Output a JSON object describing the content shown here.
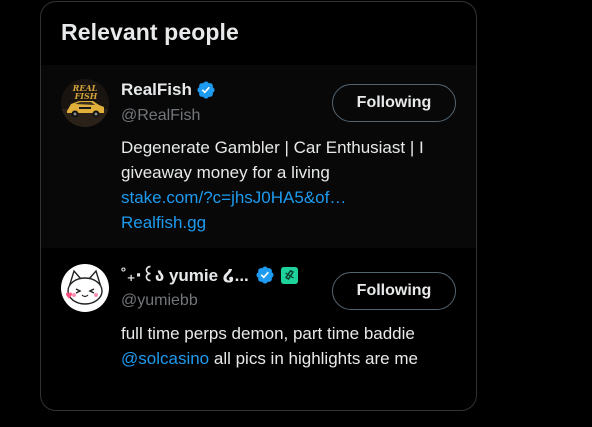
{
  "panel": {
    "title": "Relevant people"
  },
  "people": [
    {
      "display_name": "RealFish",
      "handle": "@RealFish",
      "verified": true,
      "follow_label": "Following",
      "bio_text": "Degenerate Gambler | Car Enthusiast | I giveaway money for a living",
      "bio_link_1": "stake.com/?c=jhsJ0HA5&of…",
      "bio_link_2": "Realfish.gg",
      "avatar_text": "REAL FISH"
    },
    {
      "display_name": "˚₊‧꒰ა yumie ໒...",
      "handle": "@yumiebb",
      "verified": true,
      "follow_label": "Following",
      "bio_before": "full time perps demon, part time baddie ",
      "bio_mention": "@solcasino",
      "bio_after": " all pics in highlights are me"
    }
  ],
  "colors": {
    "background": "#000000",
    "text": "#e7e9ea",
    "muted": "#71767b",
    "link": "#1d9bf0",
    "verified": "#1d9bf0",
    "affiliate_badge": "#1dd39b",
    "border": "#2f3336"
  },
  "icons": {
    "verified": "verified-badge-icon",
    "affiliate": "affiliate-badge-icon"
  }
}
